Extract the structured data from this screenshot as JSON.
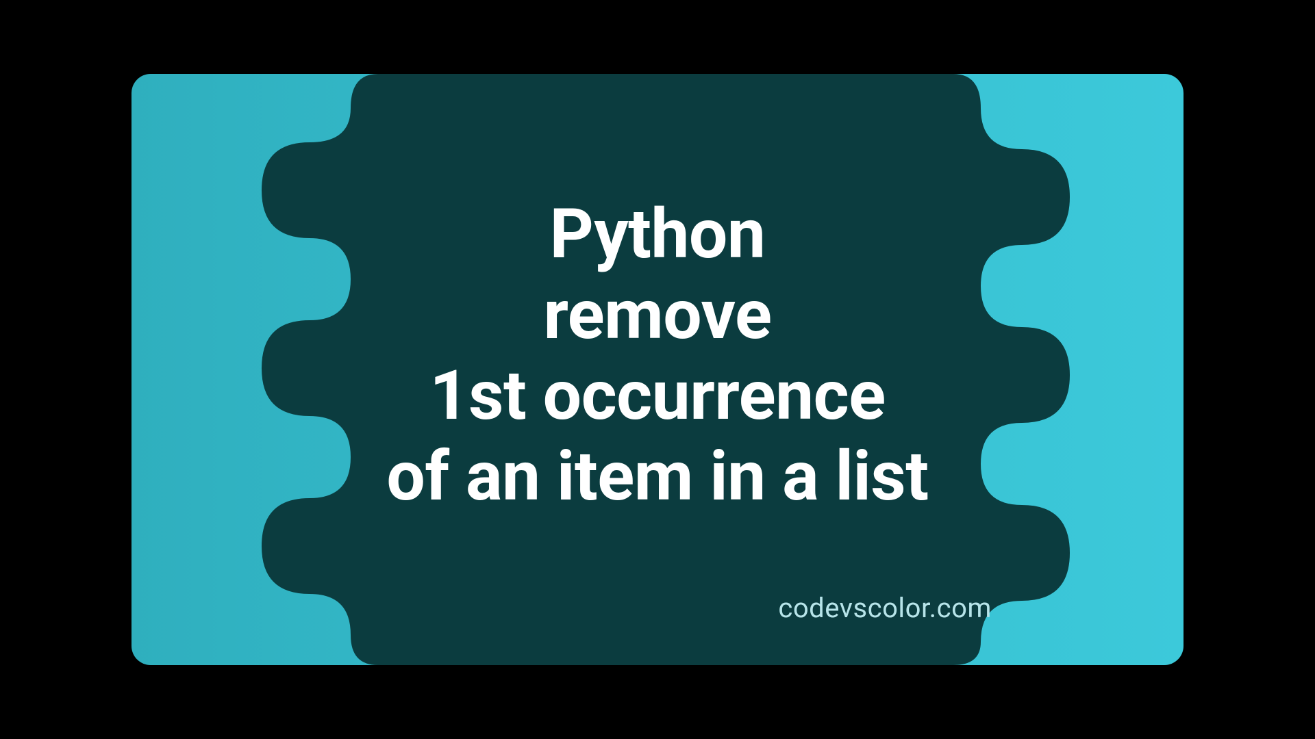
{
  "title_lines": [
    "Python",
    "remove",
    "1st occurrence",
    "of an item in a list"
  ],
  "watermark": "codevscolor.com",
  "colors": {
    "bg_gradient_from": "#2FAFBE",
    "bg_gradient_to": "#3CC9DA",
    "blob": "#0B3C3F",
    "text": "#FFFFFF",
    "watermark": "#B7E4E9"
  }
}
